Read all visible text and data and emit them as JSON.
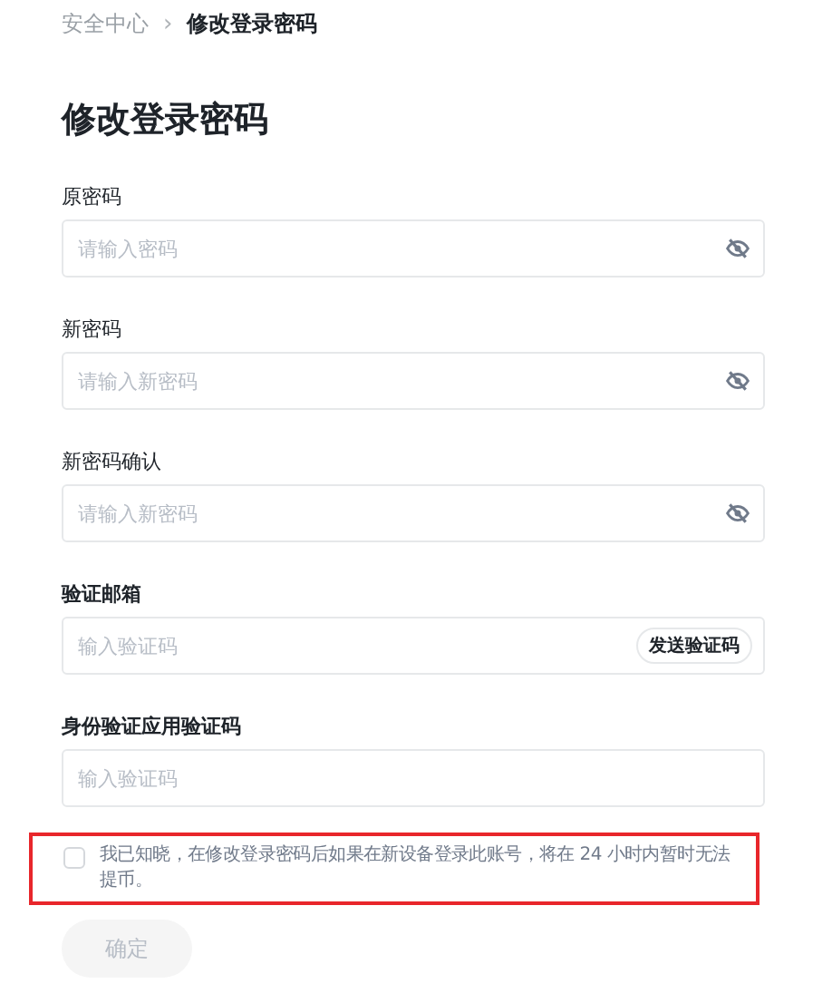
{
  "breadcrumb": [
    {
      "label": "安全中心",
      "current": false
    },
    {
      "label": "修改登录密码",
      "current": true
    }
  ],
  "breadcrumb_separator": "›",
  "title": "修改登录密码",
  "fields": [
    {
      "label": "原密码",
      "placeholder": "请输入密码",
      "kind": "password"
    },
    {
      "label": "新密码",
      "placeholder": "请输入新密码",
      "kind": "password"
    },
    {
      "label": "新密码确认",
      "placeholder": "请输入新密码",
      "kind": "password"
    },
    {
      "label": "验证邮箱",
      "placeholder": "输入验证码",
      "kind": "code",
      "action": "发送验证码"
    },
    {
      "label": "身份验证应用验证码",
      "placeholder": "输入验证码",
      "kind": "plain"
    }
  ],
  "agreement": {
    "text": "我已知晓，在修改登录密码后如果在新设备登录此账号，将在 24 小时内暂时无法提币。",
    "checked": false,
    "highlighted": true
  },
  "submit": {
    "label": "确定",
    "disabled": true
  }
}
